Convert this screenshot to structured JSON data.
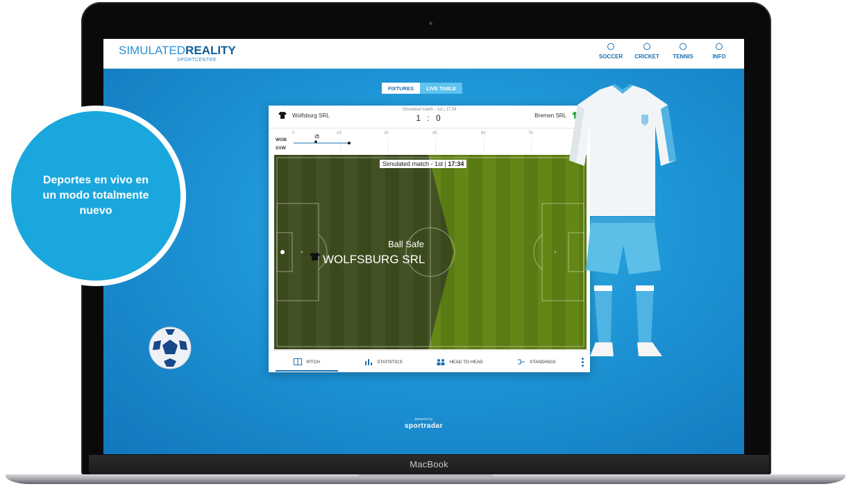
{
  "device": {
    "label": "MacBook"
  },
  "brand": {
    "light": "SIMULATED",
    "bold": "REALITY",
    "sub": "SPORTCENTRE"
  },
  "nav": [
    {
      "label": "SOCCER",
      "icon": "soccer-icon"
    },
    {
      "label": "CRICKET",
      "icon": "cricket-icon"
    },
    {
      "label": "TENNIS",
      "icon": "tennis-icon"
    },
    {
      "label": "INFO",
      "icon": "info-icon"
    }
  ],
  "toggle": {
    "fixtures": "FIXTURES",
    "live_table": "LIVE TABLE"
  },
  "match": {
    "home": "Wolfsburg SRL",
    "away": "Bremen SRL",
    "status": "Simulated match - 1st | 17:34",
    "score": "1 : 0",
    "home_short": "WOB",
    "away_short": "SVW",
    "ticks": [
      "0",
      "15",
      "30",
      "45",
      "60",
      "75",
      "90"
    ]
  },
  "pitch": {
    "status_prefix": "Simulated match - 1st",
    "status_time": "17:34",
    "event": "Ball Safe",
    "team": "WOLFSBURG SRL"
  },
  "tabs": [
    {
      "label": "PITCH",
      "icon": "pitch-icon"
    },
    {
      "label": "STATISTICS",
      "icon": "statistics-icon"
    },
    {
      "label": "HEAD TO HEAD",
      "icon": "head-to-head-icon"
    },
    {
      "label": "STANDINGS",
      "icon": "standings-icon"
    }
  ],
  "powered": {
    "small": "powered by",
    "logo": "sportradar"
  },
  "callout": {
    "text": "Deportes en vivo en un modo totalmente nuevo"
  },
  "colors": {
    "accent": "#1a6fb0",
    "callout": "#1aa7dd",
    "pitch_dark": "#3d4a1f",
    "pitch_light": "#5b7a14"
  }
}
